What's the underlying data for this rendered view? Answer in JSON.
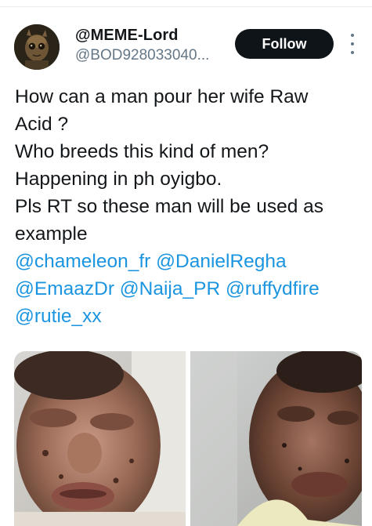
{
  "tweet": {
    "author": {
      "display_name": "@MEME-Lord",
      "handle": "@BOD928033040...",
      "avatar_icon": "avatar-groot-icon"
    },
    "follow_label": "Follow",
    "more_icon": "more-vertical-icon",
    "text_lines": [
      "How can a man pour her wife Raw",
      "Acid ?",
      "Who breeds this kind of men?",
      "Happening in ph oyigbo.",
      "Pls RT so these man will be used as",
      "example"
    ],
    "mention_lines": [
      [
        "@chameleon_fr",
        "@DanielRegha"
      ],
      [
        "@EmaazDr",
        "@Naija_PR",
        "@ruffydfire"
      ],
      [
        "@rutie_xx"
      ]
    ],
    "media": [
      {
        "icon": "photo-1"
      },
      {
        "icon": "photo-2"
      }
    ]
  },
  "colors": {
    "link": "#1b95e0",
    "text": "#14171a",
    "secondary": "#657786",
    "button_bg": "#0f1419"
  }
}
